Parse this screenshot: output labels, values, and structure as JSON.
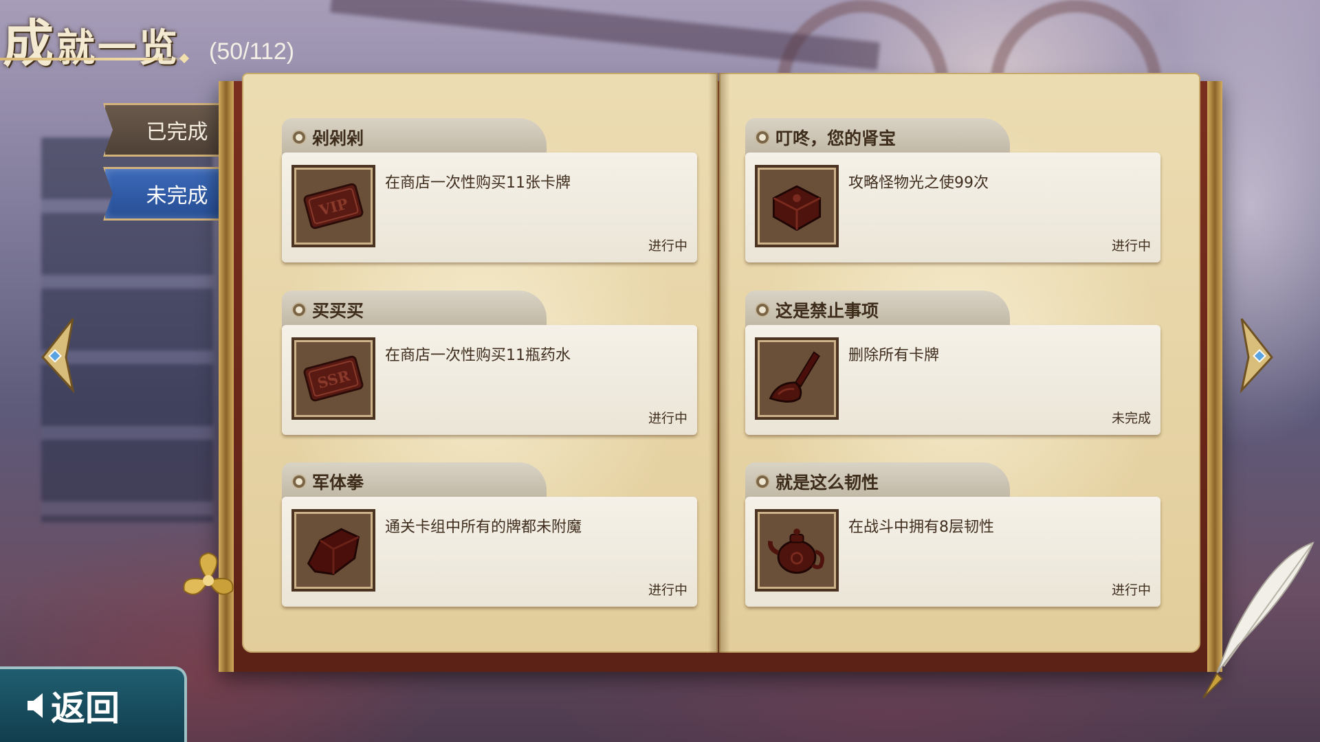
{
  "header": {
    "title_first": "成",
    "title_rest": "就一览",
    "counter": "(50/112)"
  },
  "tabs": [
    {
      "label": "已完成",
      "active": false
    },
    {
      "label": "未完成",
      "active": true
    }
  ],
  "achievements": [
    {
      "title": "剁剁剁",
      "desc": "在商店一次性购买11张卡牌",
      "status": "进行中",
      "icon": "vip-card-icon"
    },
    {
      "title": "叮咚，您的肾宝",
      "desc": "攻略怪物光之使99次",
      "status": "进行中",
      "icon": "box-icon"
    },
    {
      "title": "买买买",
      "desc": "在商店一次性购买11瓶药水",
      "status": "进行中",
      "icon": "ssr-card-icon"
    },
    {
      "title": "这是禁止事项",
      "desc": "删除所有卡牌",
      "status": "未完成",
      "icon": "shovel-icon"
    },
    {
      "title": "军体拳",
      "desc": "通关卡组中所有的牌都未附魔",
      "status": "进行中",
      "icon": "rock-icon"
    },
    {
      "title": "就是这么韧性",
      "desc": "在战斗中拥有8层韧性",
      "status": "进行中",
      "icon": "teapot-icon"
    }
  ],
  "icon_labels": {
    "vip": "VIP",
    "ssr": "SSR"
  },
  "back_button": {
    "label": "返回"
  },
  "colors": {
    "active_tab": "#2f5ca8",
    "inactive_tab": "#5c4d40",
    "page": "#e8d7aa",
    "cover": "#6b2819",
    "back_button": "#174a5c"
  }
}
